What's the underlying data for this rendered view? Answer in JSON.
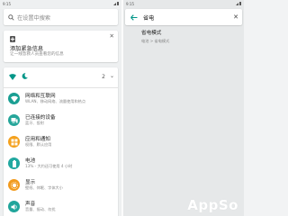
{
  "colors": {
    "accent": "#009688",
    "icon_network": "#1a9f93",
    "icon_devices": "#26a69a",
    "icon_apps": "#f4a11d",
    "icon_battery": "#22a8a0",
    "icon_display": "#f29b1e",
    "icon_sound": "#20a59b"
  },
  "left": {
    "status": {
      "time": "9:15"
    },
    "search": {
      "placeholder": "在设置中搜索",
      "icon": "search-icon"
    },
    "emergency_card": {
      "title": "添加紧急信息",
      "subtitle": "让一线急救人员查看您的信息",
      "close_icon": "close-icon"
    },
    "quick_settings": {
      "count": "2",
      "icons": [
        "wifi-icon",
        "dnd-moon-icon"
      ]
    },
    "items": [
      {
        "title": "网络和互联网",
        "subtitle": "WLAN、移动网络、流量使用和热点",
        "icon": "wifi-icon"
      },
      {
        "title": "已连接的设备",
        "subtitle": "蓝牙、投射",
        "icon": "devices-icon"
      },
      {
        "title": "应用和通知",
        "subtitle": "权限、默认应用",
        "icon": "apps-icon"
      },
      {
        "title": "电池",
        "subtitle": "13% - 大约还可使用 4 小时",
        "icon": "battery-icon"
      },
      {
        "title": "显示",
        "subtitle": "壁纸、休眠、字体大小",
        "icon": "display-icon"
      },
      {
        "title": "声音",
        "subtitle": "音量、振动、勿扰",
        "icon": "sound-icon"
      }
    ]
  },
  "right": {
    "status": {
      "time": "9:15"
    },
    "search": {
      "value": "省电",
      "back_icon": "back-arrow-icon",
      "clear_icon": "close-icon"
    },
    "result": {
      "title": "省电模式",
      "breadcrumb": "电池 > 省电模式"
    }
  },
  "watermark": "AppSo"
}
